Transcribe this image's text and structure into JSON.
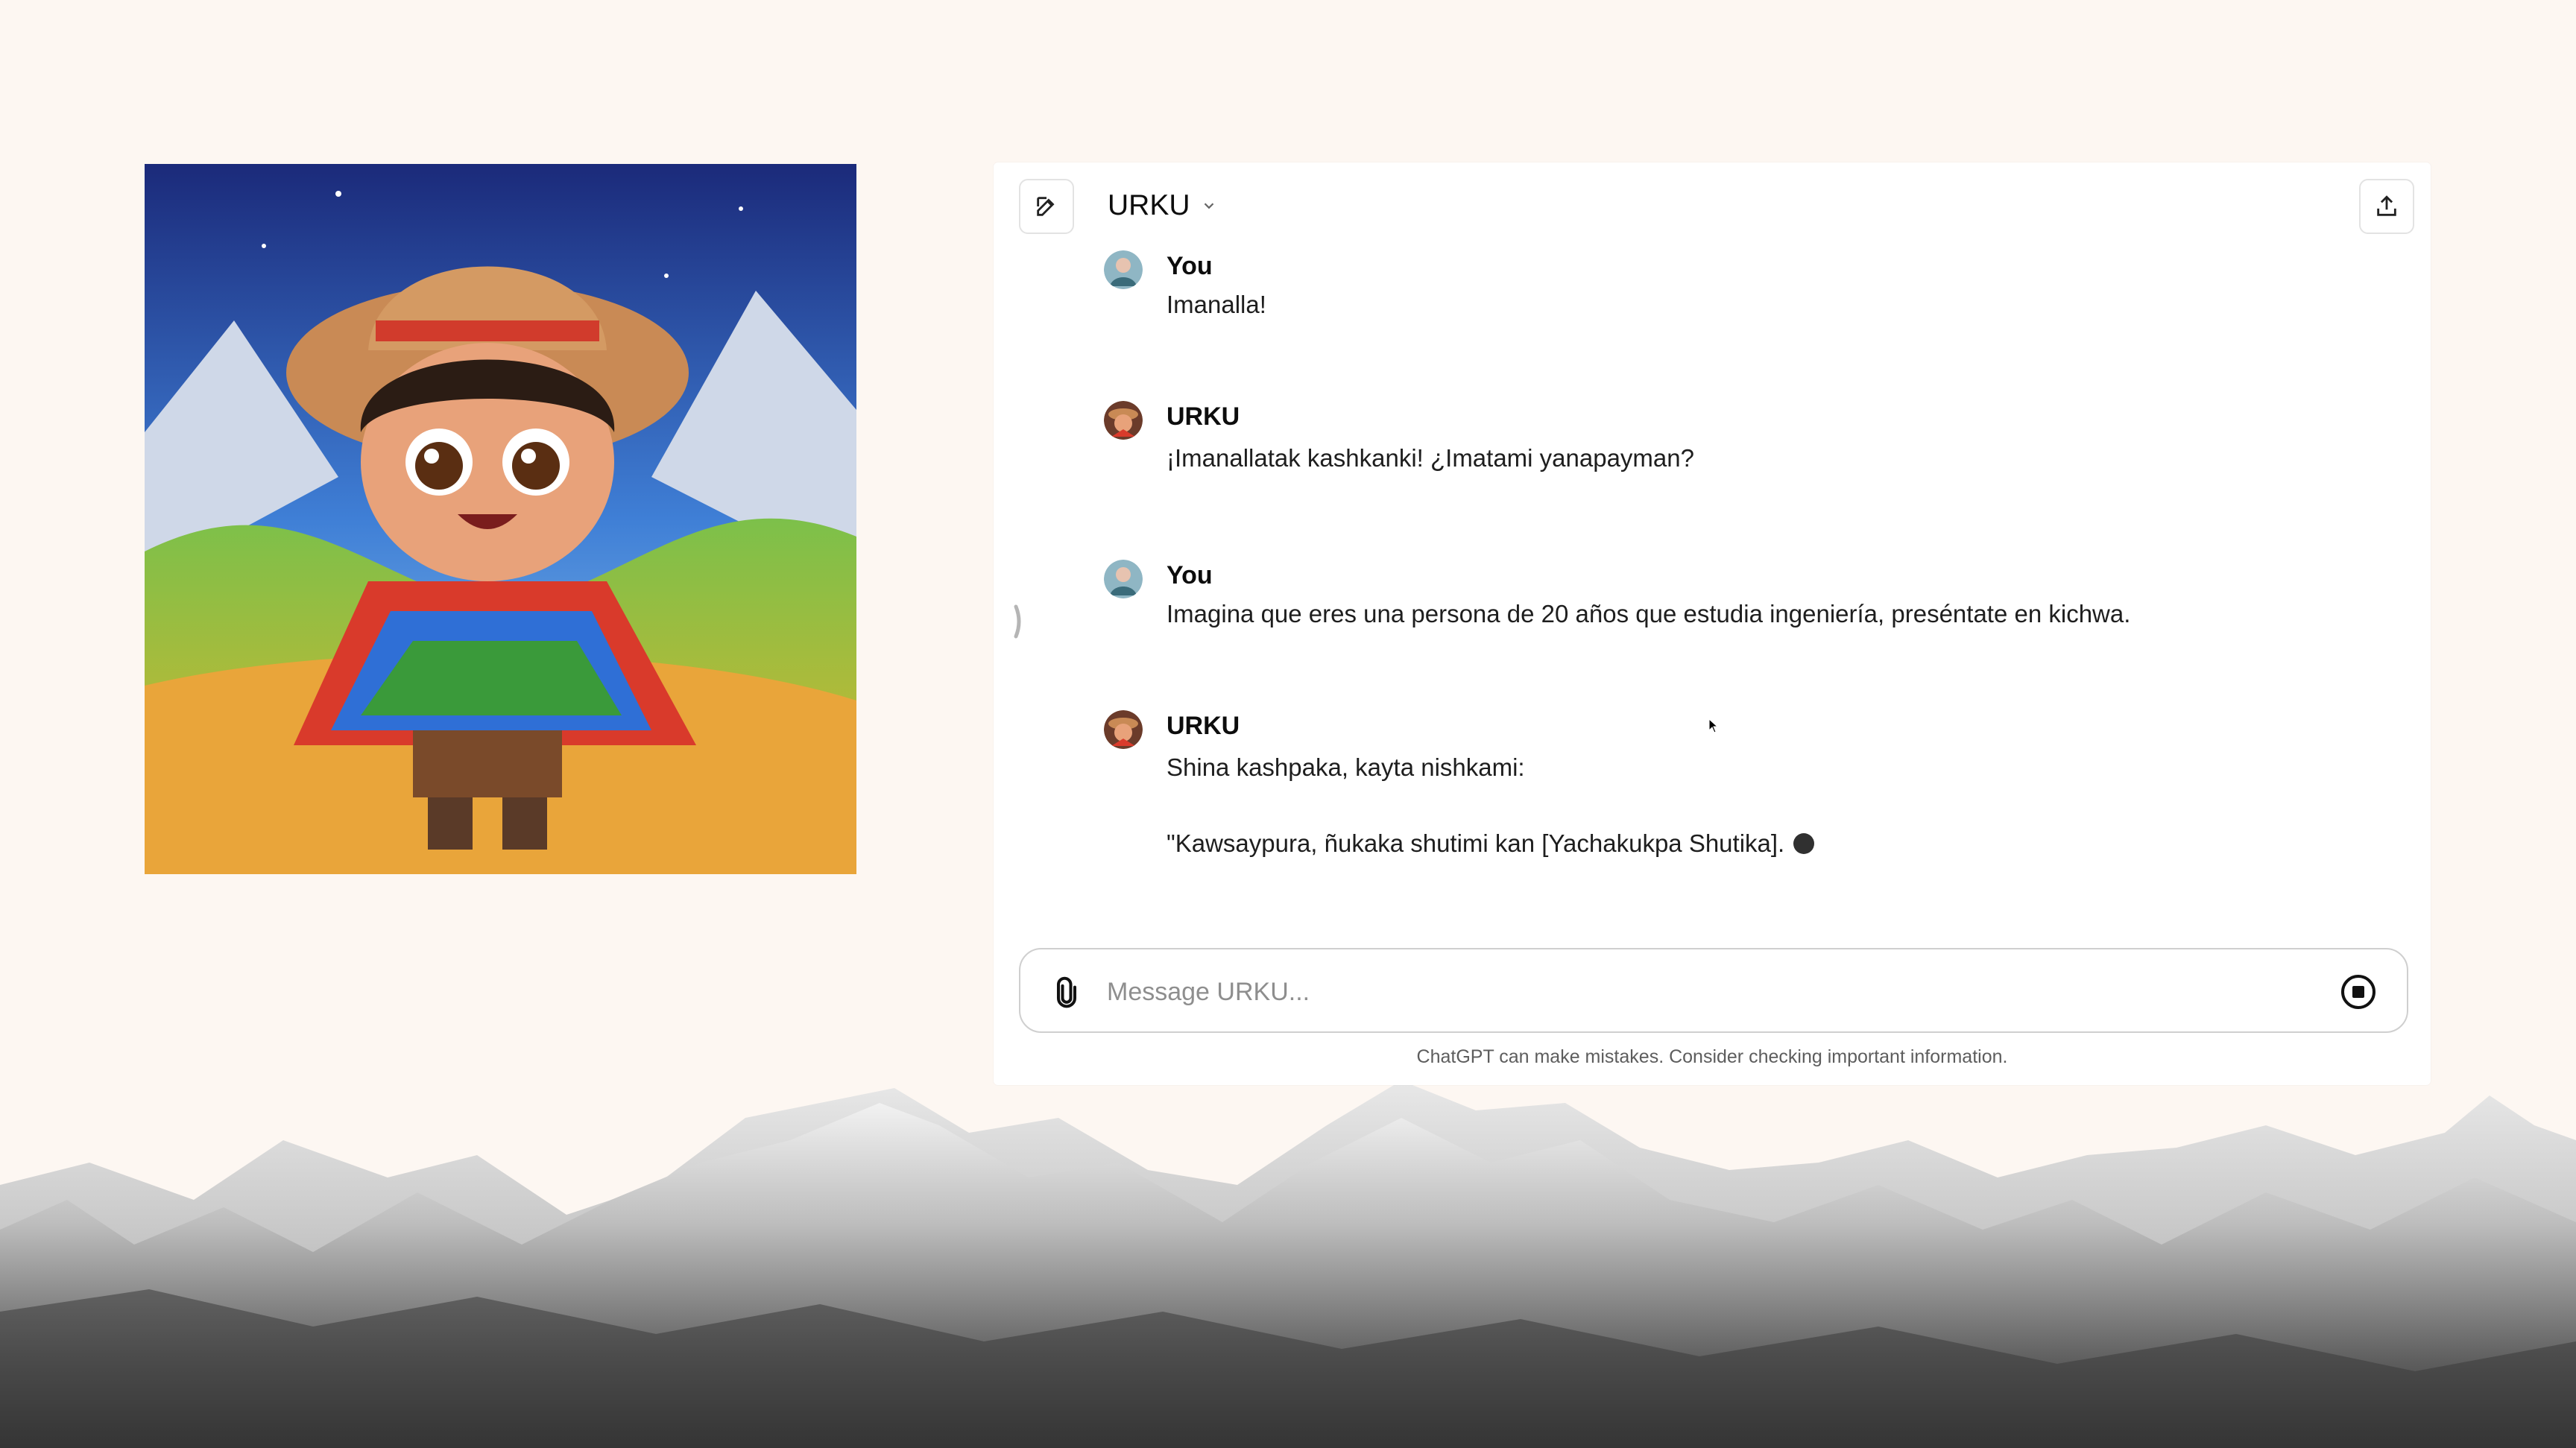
{
  "header": {
    "gpt_name": "URKU",
    "new_chat_icon": "edit-icon",
    "share_icon": "share-icon"
  },
  "messages": [
    {
      "author": "You",
      "text": "Imanalla!"
    },
    {
      "author": "URKU",
      "text": "¡Imanallatak kashkanki! ¿Imatami yanapayman?"
    },
    {
      "author": "You",
      "text": "Imagina que eres una persona de 20 años que estudia ingeniería, preséntate en kichwa."
    },
    {
      "author": "URKU",
      "text": "Shina kashpaka, kayta nishkami:",
      "text2": "\"Kawsaypura, ñukaka shutimi kan [Yachakukpa Shutika]."
    }
  ],
  "composer": {
    "placeholder": "Message URKU...",
    "attach_icon": "paperclip-icon",
    "stop_icon": "stop-icon"
  },
  "footer": {
    "disclaimer": "ChatGPT can make mistakes. Consider checking important information."
  },
  "colors": {
    "background": "#fdf7f2",
    "panel": "#ffffff",
    "text": "#0d0d0d",
    "muted": "#5d5d5d"
  }
}
